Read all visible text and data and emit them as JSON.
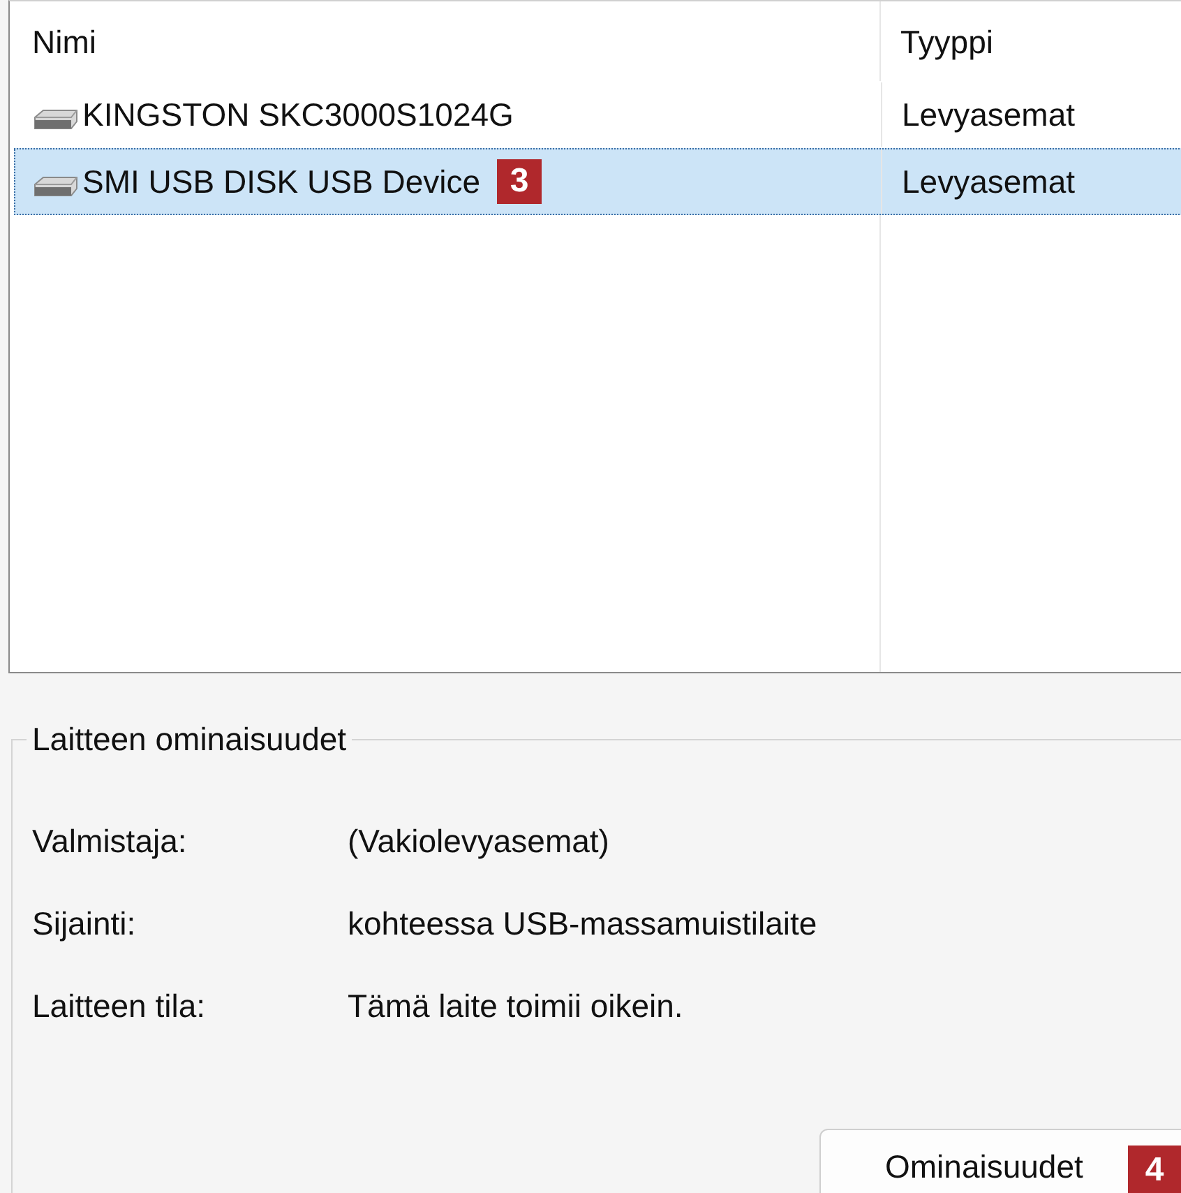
{
  "list": {
    "columns": [
      "Nimi",
      "Tyyppi"
    ],
    "rows": [
      {
        "name": "KINGSTON SKC3000S1024G",
        "type": "Levyasemat",
        "selected": false
      },
      {
        "name": "SMI USB DISK USB Device",
        "type": "Levyasemat",
        "selected": true,
        "callout": "3"
      }
    ]
  },
  "properties": {
    "title": "Laitteen ominaisuudet",
    "fields": [
      {
        "label": "Valmistaja:",
        "value": "(Vakiolevyasemat)"
      },
      {
        "label": "Sijainti:",
        "value": "kohteessa USB-massamuistilaite"
      },
      {
        "label": "Laitteen tila:",
        "value": "Tämä laite toimii oikein."
      }
    ],
    "button": {
      "label": "Ominaisuudet",
      "callout": "4"
    }
  }
}
